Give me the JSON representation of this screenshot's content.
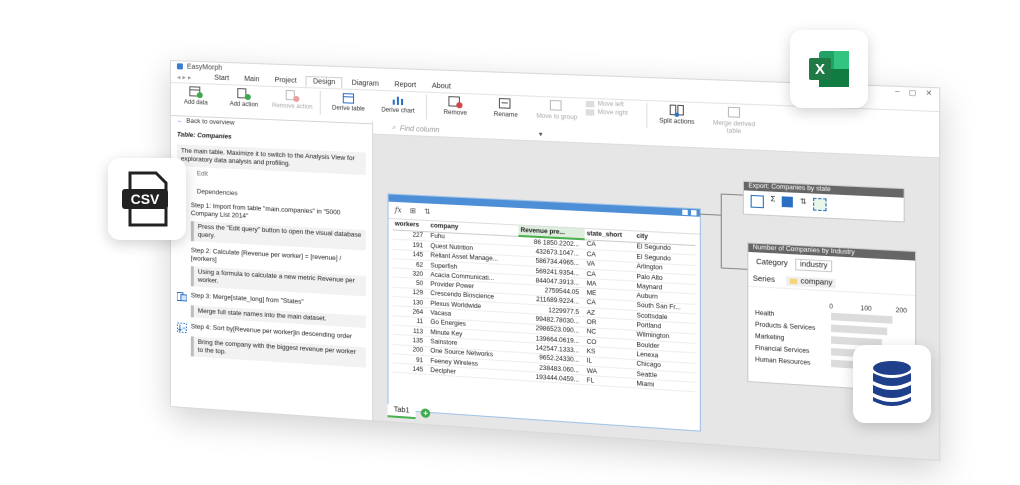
{
  "app": {
    "title": "EasyMorph",
    "menu": [
      "Start",
      "Main",
      "Project",
      "Design",
      "Diagram",
      "Report",
      "About"
    ],
    "active_menu": "Design"
  },
  "ribbon": {
    "add_data": "Add data",
    "add_action": "Add action",
    "remove_action": "Remove action",
    "derive_table": "Derive table",
    "derive_chart": "Derive chart",
    "remove": "Remove",
    "rename": "Rename",
    "move_to_group": "Move to group",
    "move_left": "Move left",
    "move_right": "Move right",
    "split_actions": "Split actions",
    "merge_derived": "Merge derived table"
  },
  "left_panel": {
    "back": "Back to overview",
    "table_title": "Table: Companies",
    "main_note": "The main table. Maximize it to switch to the Analysis View for exploratory data analysis and profiling.",
    "edit": "Edit",
    "dependencies": "Dependencies",
    "step1": "Step 1: Import from table \"main.companies\" in \"5000 Company List 2014\"",
    "step1_note": "Press the \"Edit query\" button to open the visual database query.",
    "step2": "Step 2: Calculate [Revenue per worker] = [revenue] / [workers]",
    "step2_note": "Using a formula to calculate a new metric Revenue per worker.",
    "step3": "Step 3: Merge[state_long] from \"States\"",
    "step3_note": "Merge full state names into the main dataset.",
    "step4": "Step 4: Sort by[Revenue per worker]in descending order",
    "step4_note": "Bring the company with the biggest revenue per worker to the top."
  },
  "find_column": {
    "placeholder": "Find column"
  },
  "grid": {
    "columns": [
      "workers",
      "company",
      "Revenue pre...",
      "state_short",
      "city"
    ],
    "rows": [
      [
        "227",
        "Fuhu",
        "86 1850.2202...",
        "CA",
        "El Segundo"
      ],
      [
        "191",
        "Quest Nutrition",
        "432673.1047...",
        "CA",
        "El Segundo"
      ],
      [
        "145",
        "Reliant Asset Manage...",
        "586734.4965...",
        "VA",
        "Arlington"
      ],
      [
        "62",
        "Superfish",
        "569241.9354...",
        "CA",
        "Palo Alto"
      ],
      [
        "320",
        "Acacia Communicati...",
        "844047.3913...",
        "MA",
        "Maynard"
      ],
      [
        "50",
        "Provider Power",
        "2759544.05",
        "ME",
        "Auburn"
      ],
      [
        "129",
        "Crescendo Bioscience",
        "211689.9224...",
        "CA",
        "South San Fr..."
      ],
      [
        "130",
        "Plexus Worldwide",
        "1229977.5",
        "AZ",
        "Scottsdale"
      ],
      [
        "264",
        "Vacasa",
        "99482.78030...",
        "OR",
        "Portland"
      ],
      [
        "11",
        "Go Energies",
        "2986523.090...",
        "NC",
        "Wilmington"
      ],
      [
        "113",
        "Minute Key",
        "139664.0619...",
        "CO",
        "Boulder"
      ],
      [
        "135",
        "Sainstore",
        "142547.1333...",
        "KS",
        "Lenexa"
      ],
      [
        "200",
        "One Source Networks",
        "9652.24330...",
        "IL",
        "Chicago"
      ],
      [
        "91",
        "Feeney Wireless",
        "238483.060...",
        "WA",
        "Seattle"
      ],
      [
        "145",
        "Decipher",
        "193444.0459...",
        "FL",
        "Miami"
      ]
    ]
  },
  "tabs": {
    "tab1": "Tab1"
  },
  "export": {
    "title": "Export: Companies by state"
  },
  "chart_panel": {
    "title": "Number of Companies by Industry",
    "category_tab": "Category",
    "category_value": "industry",
    "series_label": "Series",
    "series_value": "company"
  },
  "chart_data": {
    "type": "bar",
    "orientation": "horizontal",
    "categories": [
      "Health",
      "Products & Services",
      "Marketing",
      "Financial Services",
      "Human Resources"
    ],
    "values": [
      175,
      160,
      145,
      135,
      120
    ],
    "xlim": [
      0,
      200
    ],
    "xticks": [
      "0",
      "100",
      "200"
    ],
    "bar_color": "#dcdcdc"
  },
  "badges": {
    "csv": "CSV",
    "excel_color": "#1f7a45",
    "db_color": "#1e3f8a"
  }
}
